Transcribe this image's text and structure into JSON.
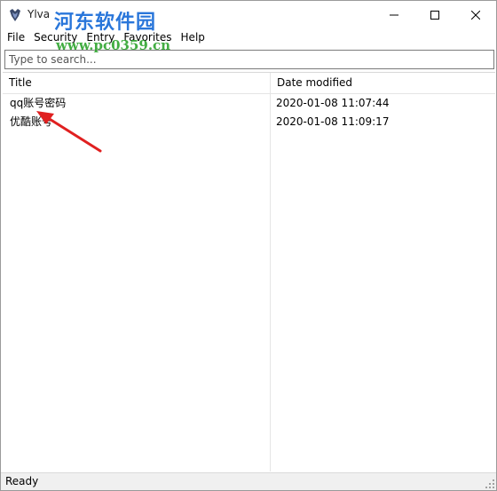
{
  "window": {
    "title": "Ylva",
    "controls": {
      "minimize": "minimize",
      "maximize": "maximize",
      "close": "close"
    }
  },
  "watermark": {
    "logo": "河东软件园",
    "url": "www.pc0359.cn"
  },
  "menu": {
    "items": [
      "File",
      "Security",
      "Entry",
      "Favorites",
      "Help"
    ]
  },
  "search": {
    "placeholder": "Type to search...",
    "value": ""
  },
  "list": {
    "columns": [
      "Title",
      "Date modified"
    ],
    "rows": [
      {
        "title": "qq账号密码",
        "date": "2020-01-08 11:07:44"
      },
      {
        "title": "优酷账号",
        "date": "2020-01-08 11:09:17"
      }
    ]
  },
  "status": {
    "text": "Ready"
  },
  "colors": {
    "annotation_arrow": "#e02020",
    "watermark_logo": "#1e6fd9",
    "watermark_url": "#2ea52e"
  }
}
